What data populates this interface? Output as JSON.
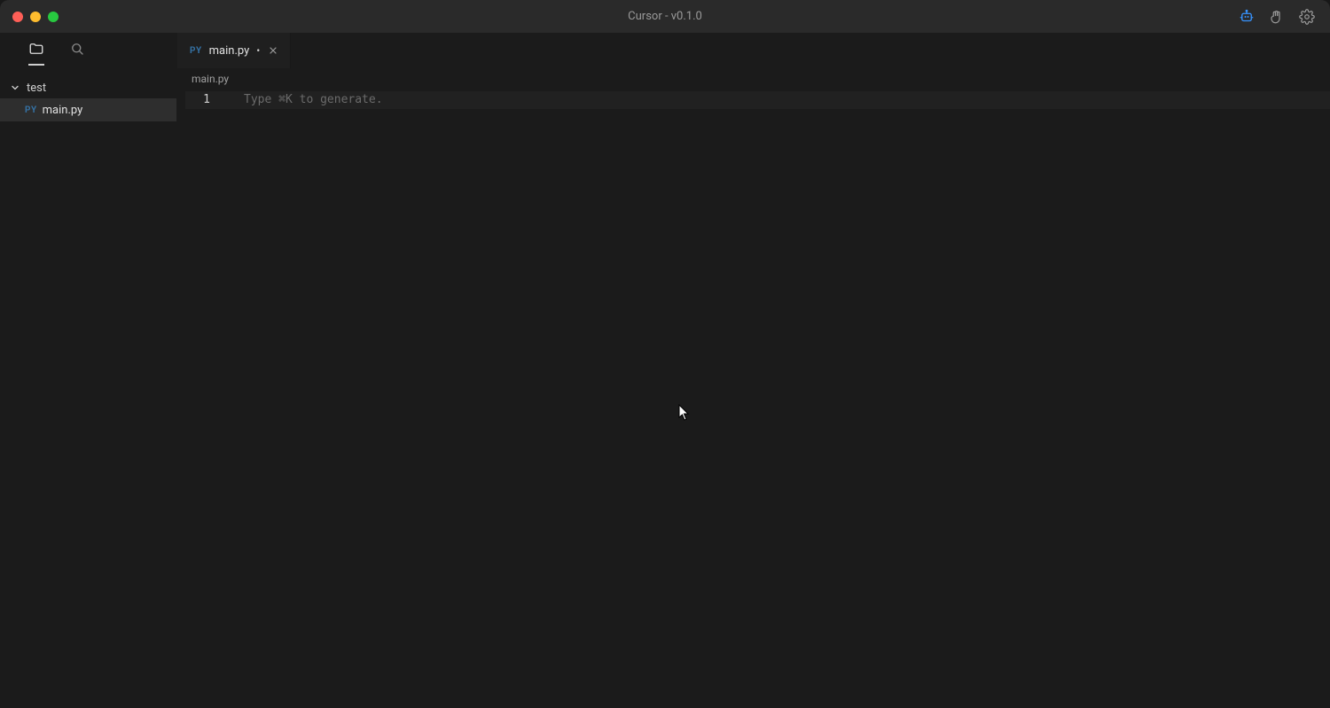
{
  "window": {
    "title": "Cursor - v0.1.0"
  },
  "titlebar_icons": {
    "ai": "ai-robot-icon",
    "hand": "hand-wave-icon",
    "settings": "gear-icon"
  },
  "sidebar": {
    "tabs": {
      "explorer": "folder-icon",
      "search": "search-icon"
    },
    "root": {
      "label": "test",
      "expanded": true
    },
    "files": [
      {
        "badge": "PY",
        "name": "main.py",
        "selected": true
      }
    ]
  },
  "editorTabs": [
    {
      "badge": "PY",
      "label": "main.py",
      "dirty": true,
      "dirtyMark": "•"
    }
  ],
  "breadcrumb": "main.py",
  "editor": {
    "lineNumbers": [
      "1"
    ],
    "placeholder": "Type ⌘K to generate."
  }
}
